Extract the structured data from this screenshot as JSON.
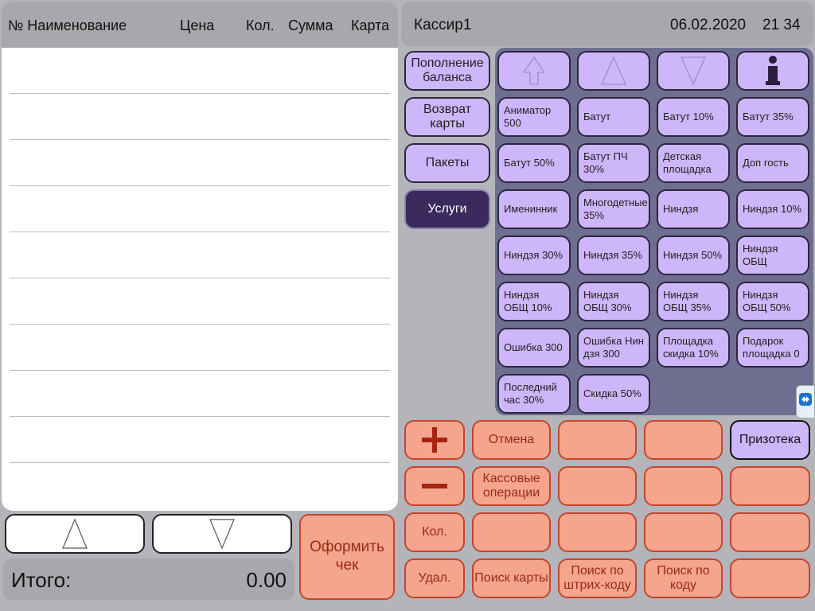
{
  "receipt": {
    "columns": [
      "№ Наименование",
      "Цена",
      "Кол.",
      "Сумма",
      "Карта"
    ],
    "rows": 10
  },
  "total": {
    "label": "Итого:",
    "value": "0.00"
  },
  "checkout": {
    "label": "Оформить чек"
  },
  "topbar": {
    "cashier": "Кассир1",
    "date": "06.02.2020",
    "time": "21 34"
  },
  "categories": [
    {
      "label": "Пополнение баланса",
      "active": false
    },
    {
      "label": "Возврат карты",
      "active": false
    },
    {
      "label": "Пакеты",
      "active": false
    },
    {
      "label": "Услуги",
      "active": true
    }
  ],
  "services": [
    "Аниматор 500",
    "Батут",
    "Батут 10%",
    "Батут 35%",
    "Батут 50%",
    "Батут ПЧ 30%",
    "Детская площадка",
    "Доп гость",
    "Именинник",
    "Многодетные 35%",
    "Ниндзя",
    "Ниндзя 10%",
    "Ниндзя 30%",
    "Ниндзя 35%",
    "Ниндзя 50%",
    "Ниндзя ОБЩ",
    "Ниндзя ОБЩ 10%",
    "Ниндзя ОБЩ 30%",
    "Ниндзя ОБЩ 35%",
    "Ниндзя ОБЩ 50%",
    "Ошибка 300",
    "Ошибка Нин дзя  300",
    "Площадка скидка 10%",
    "Подарок площадка 0",
    "Последний час 30%",
    "Скидка 50%"
  ],
  "controls": {
    "plus": "+",
    "minus": "−",
    "cancel": "Отмена",
    "cash_ops": "Кассовые операции",
    "prize": "Призотека",
    "qty": "Кол.",
    "delete": "Удал.",
    "search": "Поиск карты",
    "barcode": "Поиск по штрих-коду",
    "code": "Поиск по коду"
  },
  "colors": {
    "background": "#b3b5bb",
    "service_button": "#cdb6f9",
    "active_category": "#3a2a5e",
    "service_panel": "#6e6f90",
    "control_button": "#f5a58d",
    "control_border": "#c4452d"
  }
}
